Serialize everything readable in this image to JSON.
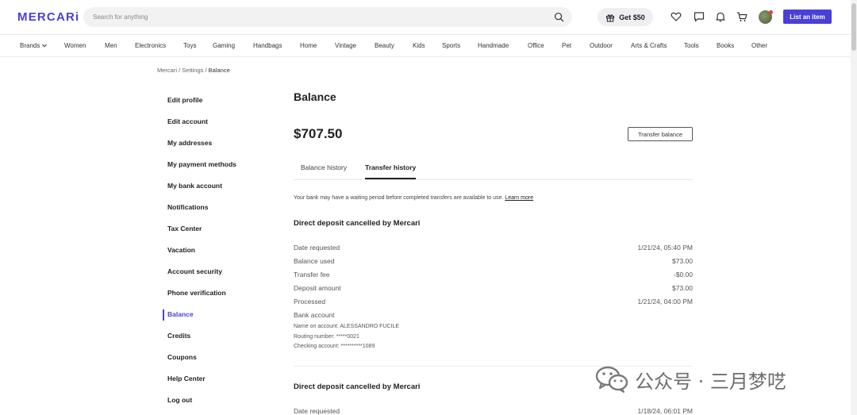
{
  "header": {
    "logo": "MERCARi",
    "search_placeholder": "Search for anything",
    "gift_label": "Get $50",
    "list_button": "List an item"
  },
  "categories": [
    "Brands",
    "Women",
    "Men",
    "Electronics",
    "Toys",
    "Gaming",
    "Handbags",
    "Home",
    "Vintage",
    "Beauty",
    "Kids",
    "Sports",
    "Handmade",
    "Office",
    "Pet",
    "Outdoor",
    "Arts & Crafts",
    "Tools",
    "Books",
    "Other"
  ],
  "breadcrumb": {
    "part1": "Mercari",
    "sep": " / ",
    "part2": "Settings",
    "current": "Balance"
  },
  "sidebar": {
    "items": [
      {
        "label": "Edit profile"
      },
      {
        "label": "Edit account"
      },
      {
        "label": "My addresses"
      },
      {
        "label": "My payment methods"
      },
      {
        "label": "My bank account"
      },
      {
        "label": "Notifications"
      },
      {
        "label": "Tax Center"
      },
      {
        "label": "Vacation"
      },
      {
        "label": "Account security"
      },
      {
        "label": "Phone verification"
      },
      {
        "label": "Balance"
      },
      {
        "label": "Credits"
      },
      {
        "label": "Coupons"
      },
      {
        "label": "Help Center"
      },
      {
        "label": "Log out"
      }
    ],
    "active": "Balance"
  },
  "main": {
    "title": "Balance",
    "amount": "$707.50",
    "transfer_button": "Transfer balance",
    "tabs": [
      {
        "label": "Balance history"
      },
      {
        "label": "Transfer history"
      }
    ],
    "active_tab": "Transfer history",
    "notice": "Your bank may have a waiting period before completed transfers are available to use.",
    "notice_link": "Learn more",
    "transfers": [
      {
        "title": "Direct deposit cancelled by Mercari",
        "rows": [
          {
            "label": "Date requested",
            "value": "1/21/24, 05:40 PM"
          },
          {
            "label": "Balance used",
            "value": "$73.00"
          },
          {
            "label": "Transfer fee",
            "value": "-$0.00"
          },
          {
            "label": "Deposit amount",
            "value": "$73.00"
          },
          {
            "label": "Processed",
            "value": "1/21/24, 04:00 PM"
          },
          {
            "label": "Bank account",
            "value": ""
          }
        ],
        "bank": [
          "Name on account: ALESSANDRO FUCILE",
          "Routing number: *****0021",
          "Checking account: **********1089"
        ]
      },
      {
        "title": "Direct deposit cancelled by Mercari",
        "rows": [
          {
            "label": "Date requested",
            "value": "1/18/24, 06:01 PM"
          }
        ]
      }
    ]
  },
  "watermark": "公众号 · 三月梦呓",
  "colors": {
    "brand": "#4a3fd8",
    "text": "#222222",
    "muted": "#555555"
  }
}
